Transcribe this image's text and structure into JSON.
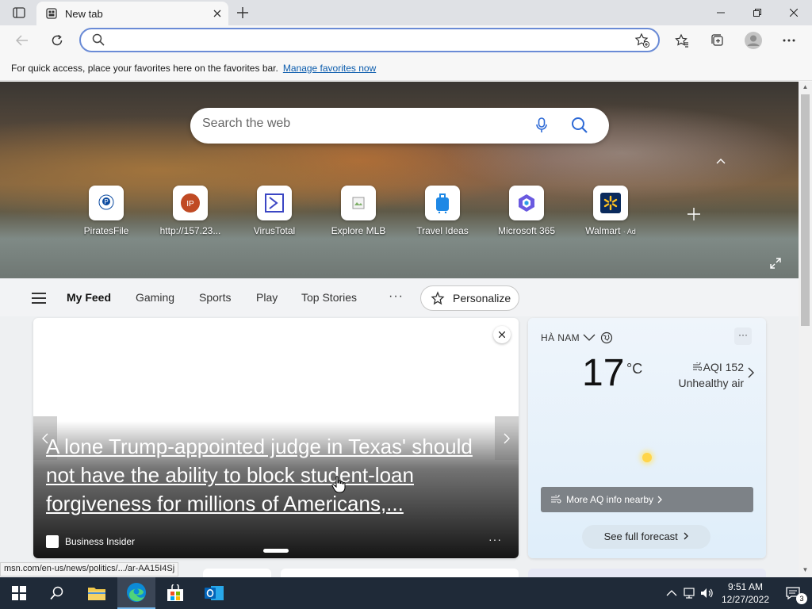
{
  "browser": {
    "tab": {
      "title": "New tab"
    },
    "address_bar": {
      "value": "",
      "placeholder": ""
    },
    "favorites_bar": {
      "message": "For quick access, place your favorites here on the favorites bar.",
      "link": "Manage favorites now"
    }
  },
  "newtab": {
    "search": {
      "placeholder": "Search the web"
    },
    "quick_links": [
      {
        "label": "PiratesFile",
        "icon": "piratesfile-icon",
        "ad": ""
      },
      {
        "label": "http://157.23...",
        "icon": "ip-icon",
        "ad": ""
      },
      {
        "label": "VirusTotal",
        "icon": "virustotal-icon",
        "ad": ""
      },
      {
        "label": "Explore MLB",
        "icon": "broken-image-icon",
        "ad": ""
      },
      {
        "label": "Travel Ideas",
        "icon": "luggage-icon",
        "ad": ""
      },
      {
        "label": "Microsoft 365",
        "icon": "m365-icon",
        "ad": ""
      },
      {
        "label": "Walmart",
        "icon": "walmart-icon",
        "ad": "· Ad"
      }
    ],
    "feed_nav": {
      "tabs": [
        "My Feed",
        "Gaming",
        "Sports",
        "Play",
        "Top Stories"
      ],
      "more": "···",
      "personalize": "Personalize"
    },
    "hero_card": {
      "headline": "A lone Trump-appointed judge in Texas' should not have the ability to block student-loan forgiveness for millions of Americans,...",
      "source": "Business Insider",
      "more": "···"
    },
    "weather": {
      "location": "HÀ NAM",
      "temperature": "17",
      "unit": "°C",
      "aqi": "AQI 152",
      "aqi_status": "Unhealthy air",
      "more_aq": "More AQ info nearby",
      "forecast": "See full forecast",
      "menu": "···"
    }
  },
  "status_url": "msn.com/en-us/news/politics/.../ar-AA15I4Sj",
  "taskbar": {
    "time": "9:51 AM",
    "date": "12/27/2022",
    "notifications": "3"
  },
  "colors": {
    "accent": "#0b5cad",
    "taskbar": "#1f2a38",
    "address_border": "#6a8bd6"
  }
}
